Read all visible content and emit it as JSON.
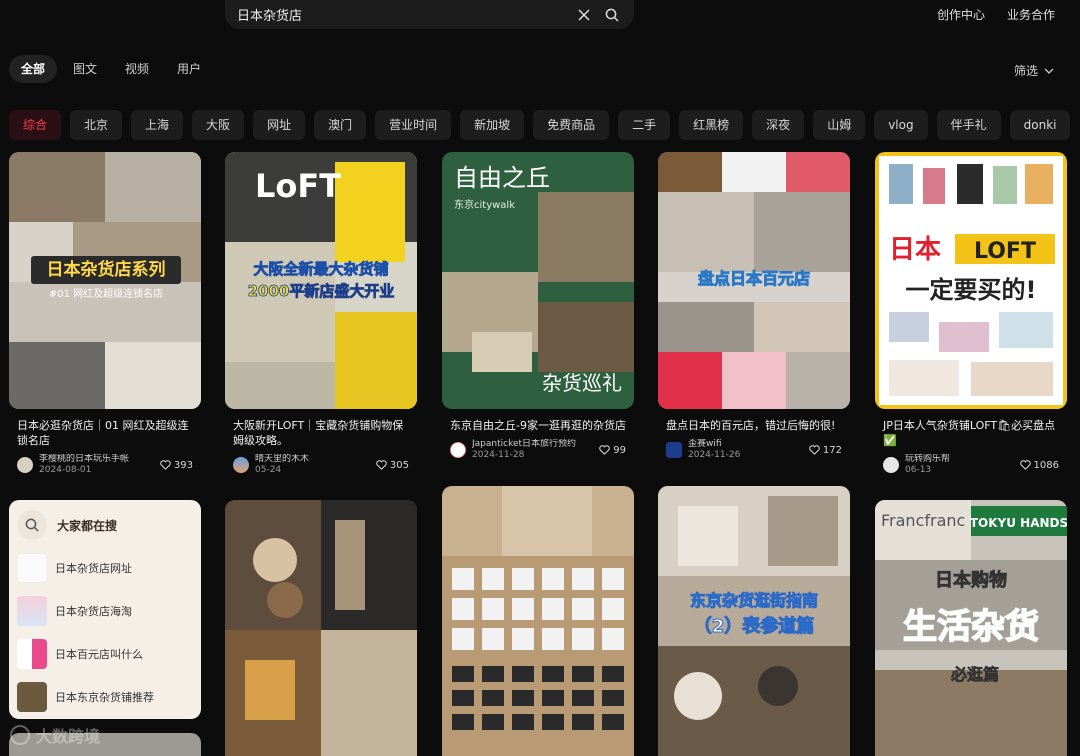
{
  "search": {
    "value": "日本杂货店"
  },
  "top_links": [
    "创作中心",
    "业务合作"
  ],
  "tabs": [
    "全部",
    "图文",
    "视频",
    "用户"
  ],
  "filter_label": "筛选",
  "chips": [
    "综合",
    "北京",
    "上海",
    "大阪",
    "网址",
    "澳门",
    "营业时间",
    "新加坡",
    "免费商品",
    "二手",
    "红黑榜",
    "深夜",
    "山姆",
    "vlog",
    "伴手礼",
    "donki"
  ],
  "cards": [
    {
      "title": "日本必逛杂货店｜01 网红及超级连锁名店",
      "author": "李樱桃的日本玩乐手帐",
      "date": "2024-08-01",
      "likes": "393",
      "overlay": "日本杂货店系列",
      "overlay2": "#01 网红及超级连锁名店"
    },
    {
      "title": "大阪新开LOFT｜宝藏杂货铺购物保姆级攻略。",
      "author": "晴天里的木木",
      "date": "05-24",
      "likes": "305",
      "overlay": "大阪全新最大杂货铺",
      "overlay2": "2000平新店盛大开业"
    },
    {
      "title": "东京自由之丘-9家一逛再逛的杂货店",
      "author": "Japanticket日本旅行预约",
      "date": "2024-11-28",
      "likes": "99",
      "overlay": "自由之丘",
      "overlay2": "东京citywalk",
      "overlay3": "杂货巡礼"
    },
    {
      "title": "盘点日本的百元店，错过后悔的很!",
      "author": "歪赛wifi",
      "date": "2024-11-26",
      "likes": "172",
      "overlay": "盘点日本百元店"
    },
    {
      "title": "JP日本人气杂货铺LOFT🛍必买盘点✅",
      "author": "玩转购乐帮",
      "date": "06-13",
      "likes": "1086",
      "overlay": "日本",
      "overlay2": "LOFT",
      "overlay3": "一定要买的!"
    }
  ],
  "hot_searches": {
    "title": "大家都在搜",
    "items": [
      "日本杂货店网址",
      "日本杂货店海淘",
      "日本百元店叫什么",
      "日本东京杂货铺推荐"
    ]
  },
  "row2": [
    {
      "overlay": "东京杂货逛街指南",
      "overlay2": "（2）表参道篇"
    },
    {
      "overlay": "日本购物",
      "overlay2": "生活杂货",
      "overlay3": "必逛篇"
    }
  ],
  "watermark": "大数跨境"
}
